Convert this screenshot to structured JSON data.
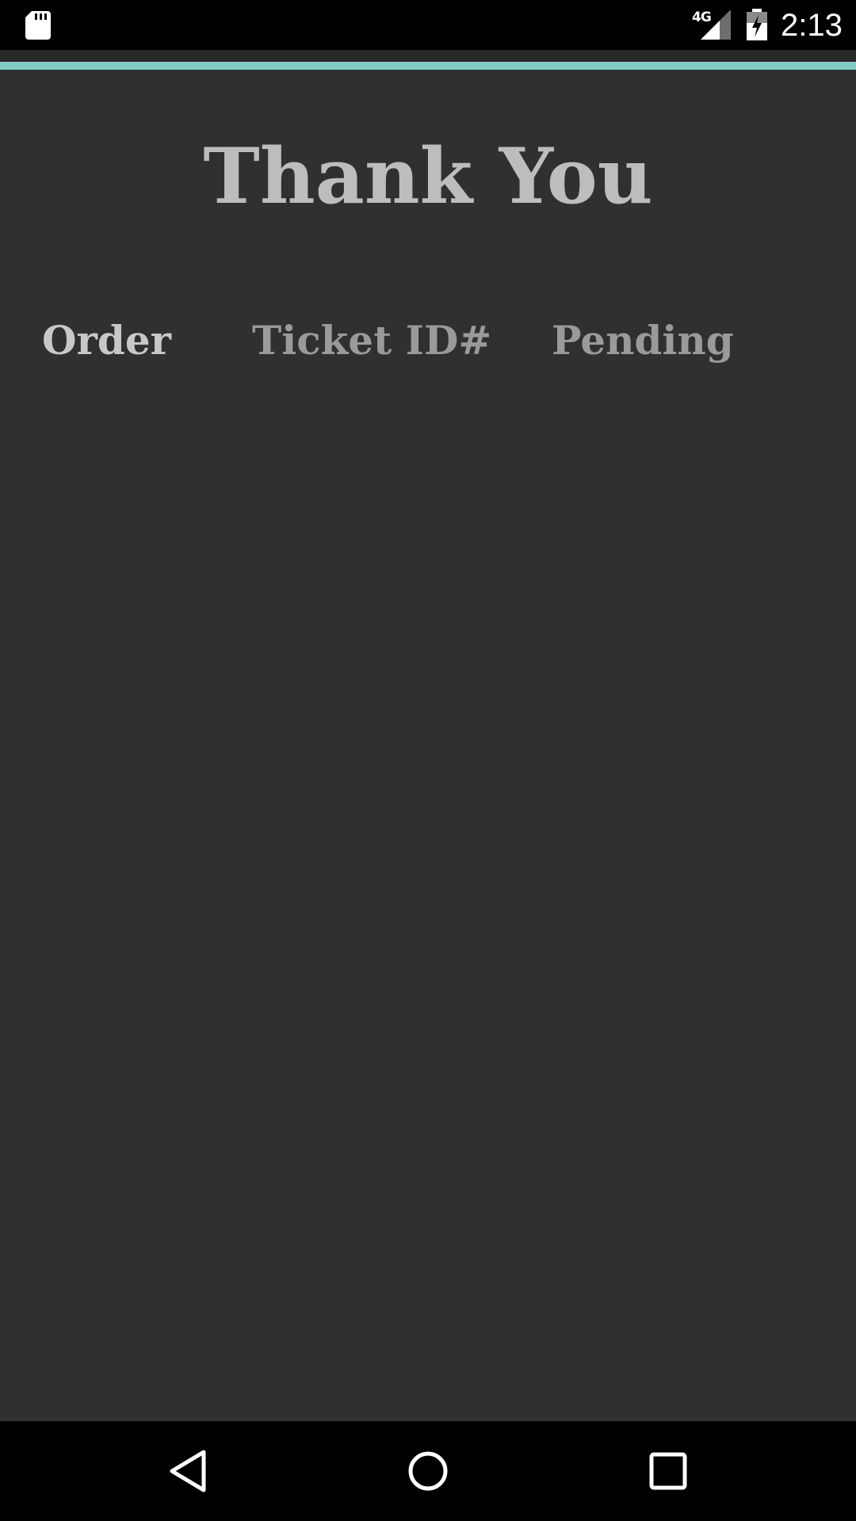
{
  "status_bar": {
    "time": "2:13",
    "network": "4G",
    "icons": [
      "sd-card-icon",
      "signal-icon",
      "battery-charging-icon"
    ]
  },
  "colors": {
    "background": "#303030",
    "accent": "#80cbc4",
    "title_text": "#bdbdbd",
    "header_primary": "#c8c8c8",
    "header_secondary": "#9a9a9a"
  },
  "page": {
    "title": "Thank You"
  },
  "table": {
    "columns": [
      "Order",
      "Ticket ID#",
      "Pending"
    ]
  },
  "nav_bar": {
    "buttons": [
      "back-icon",
      "home-icon",
      "recents-icon"
    ]
  }
}
